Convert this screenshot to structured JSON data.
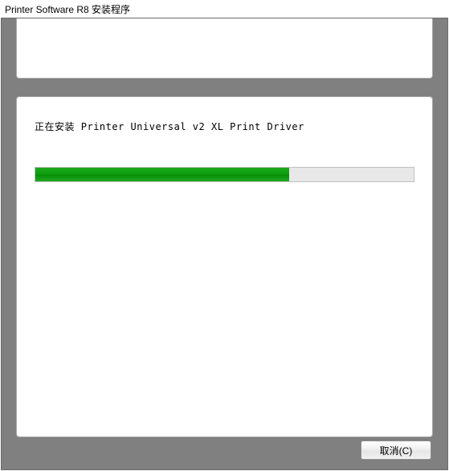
{
  "window": {
    "title": "Printer Software R8 安装程序"
  },
  "main": {
    "install_prefix": "正在安装",
    "install_target": "Printer Universal v2 XL Print Driver",
    "progress_percent": 67
  },
  "buttons": {
    "cancel_label": "取消(C)"
  }
}
